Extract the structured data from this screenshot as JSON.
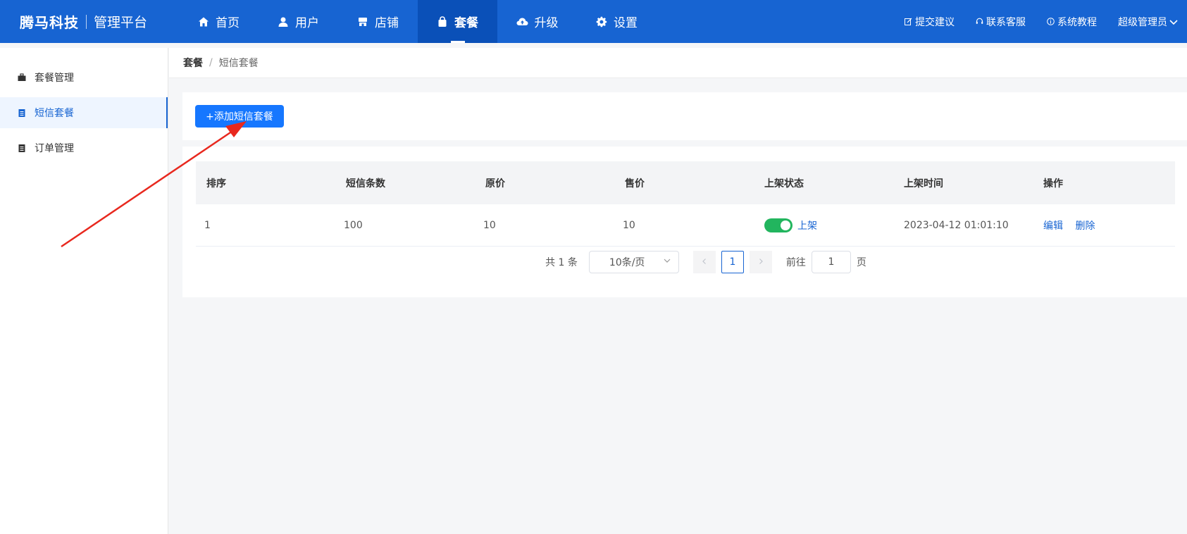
{
  "header": {
    "brand_name": "腾马科技",
    "brand_sub": "管理平台",
    "nav": [
      {
        "label": "首页",
        "icon": "home-icon"
      },
      {
        "label": "用户",
        "icon": "user-icon"
      },
      {
        "label": "店铺",
        "icon": "store-icon"
      },
      {
        "label": "套餐",
        "icon": "bag-icon",
        "active": true
      },
      {
        "label": "升级",
        "icon": "cloud-upload-icon"
      },
      {
        "label": "设置",
        "icon": "gear-icon"
      }
    ],
    "right": {
      "feedback": "提交建议",
      "support": "联系客服",
      "tutorial": "系统教程",
      "user": "超级管理员"
    },
    "colors": {
      "bar": "#1764d2",
      "active": "#0a50b8"
    }
  },
  "sidebar": {
    "items": [
      {
        "label": "套餐管理",
        "icon": "briefcase-icon"
      },
      {
        "label": "短信套餐",
        "icon": "clipboard-icon",
        "active": true
      },
      {
        "label": "订单管理",
        "icon": "clipboard-icon"
      }
    ]
  },
  "breadcrumb": {
    "first": "套餐",
    "sep": "/",
    "second": "短信套餐"
  },
  "toolbar": {
    "add_label": "+添加短信套餐"
  },
  "table": {
    "headers": [
      "排序",
      "短信条数",
      "原价",
      "售价",
      "上架状态",
      "上架时间",
      "操作"
    ],
    "rows": [
      {
        "order": "1",
        "count": "100",
        "original_price": "10",
        "sale_price": "10",
        "status": "上架",
        "status_on": true,
        "time": "2023-04-12 01:01:10",
        "edit": "编辑",
        "delete": "删除"
      }
    ]
  },
  "pagination": {
    "total": "共 1 条",
    "page_size": "10条/页",
    "current_page": "1",
    "goto_label": "前往",
    "goto_value": "1",
    "page_unit": "页"
  }
}
